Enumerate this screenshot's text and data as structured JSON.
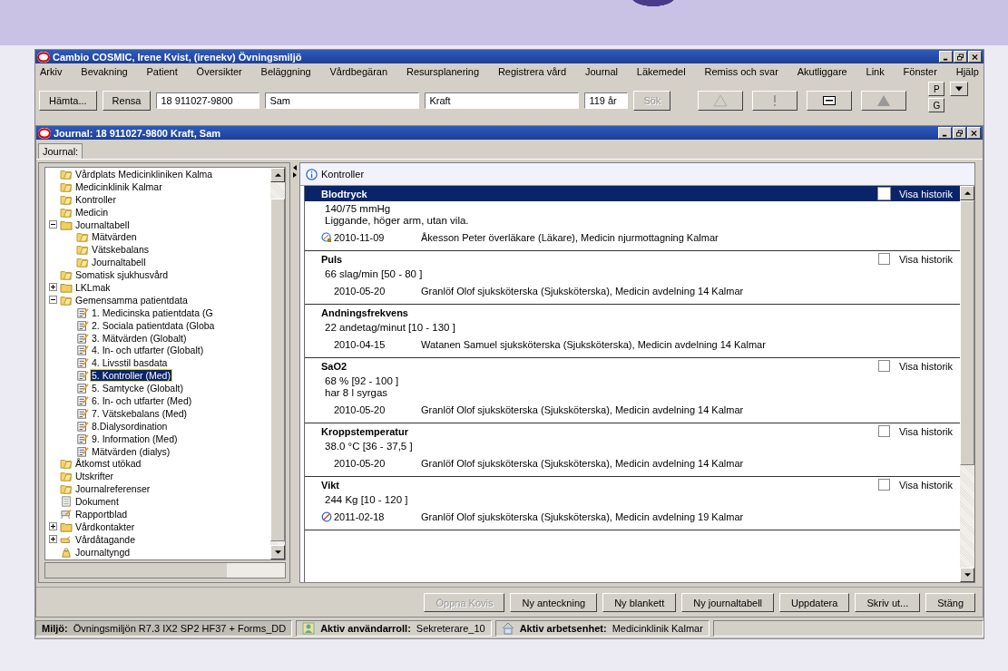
{
  "window": {
    "title": "Cambio COSMIC, Irene Kvist, (irenekv) Övningsmiljö"
  },
  "menu": [
    "Arkiv",
    "Bevakning",
    "Patient",
    "Översikter",
    "Beläggning",
    "Vårdbegäran",
    "Resursplanering",
    "Registrera vård",
    "Journal",
    "Läkemedel",
    "Remiss och svar",
    "Akutliggare",
    "Link",
    "Fönster",
    "Hjälp"
  ],
  "toolbar": {
    "fetch_button": "Hämta...",
    "clear_button": "Rensa",
    "personal_number": "18 911027-9800",
    "first_name": "Sam",
    "last_name": "Kraft",
    "age": "119 år",
    "search_button": {
      "label": "Sök",
      "disabled": true
    },
    "side_buttons": [
      "P",
      "G"
    ]
  },
  "journal_window": {
    "title": "Journal: 18 911027-9800 Kraft, Sam",
    "tabs": [
      {
        "label": "Journal:",
        "selected": true
      }
    ],
    "tree": [
      {
        "label": "Vårdplats Medicinkliniken Kalma",
        "kind": "folder",
        "selected": false
      },
      {
        "label": "Medicinklinik Kalmar",
        "kind": "folder",
        "selected": false
      },
      {
        "label": "Kontroller",
        "kind": "folder",
        "selected": false
      },
      {
        "label": "Medicin",
        "kind": "folder",
        "selected": false
      },
      {
        "label": "Journaltabell",
        "kind": "open-folder",
        "selected": false,
        "expanded": true,
        "children": [
          {
            "label": "Mätvärden",
            "kind": "folder",
            "selected": false
          },
          {
            "label": "Vätskebalans",
            "kind": "folder",
            "selected": false
          },
          {
            "label": "Journaltabell",
            "kind": "folder",
            "selected": false
          }
        ]
      },
      {
        "label": "Somatisk sjukhusvård",
        "kind": "folder",
        "selected": false
      },
      {
        "label": "LKLmak",
        "kind": "open-folder",
        "selected": false,
        "expanded": false
      },
      {
        "label": "Gemensamma patientdata",
        "kind": "folder",
        "selected": false,
        "expanded": true,
        "children": [
          {
            "label": "1. Medicinska patientdata  (G",
            "kind": "form",
            "selected": false
          },
          {
            "label": "2. Sociala patientdata  (Globa",
            "kind": "form",
            "selected": false
          },
          {
            "label": "3. Mätvärden (Globalt)",
            "kind": "form",
            "selected": false
          },
          {
            "label": "4. In- och utfarter (Globalt)",
            "kind": "form",
            "selected": false
          },
          {
            "label": "4. Livsstil basdata",
            "kind": "form",
            "selected": false
          },
          {
            "label": "5. Kontroller (Med)",
            "kind": "form",
            "selected": true
          },
          {
            "label": "5. Samtycke (Globalt)",
            "kind": "form",
            "selected": false
          },
          {
            "label": "6. In- och utfarter (Med)",
            "kind": "form",
            "selected": false
          },
          {
            "label": "7. Vätskebalans (Med)",
            "kind": "form",
            "selected": false
          },
          {
            "label": "8.Dialysordination",
            "kind": "form",
            "selected": false
          },
          {
            "label": "9. Information (Med)",
            "kind": "form",
            "selected": false
          },
          {
            "label": "Mätvärden (dialys)",
            "kind": "form",
            "selected": false
          }
        ]
      },
      {
        "label": "Åtkomst utökad",
        "kind": "folder",
        "selected": false
      },
      {
        "label": "Utskrifter",
        "kind": "folder",
        "selected": false
      },
      {
        "label": "Journalreferenser",
        "kind": "folder",
        "selected": false
      },
      {
        "label": "Dokument",
        "kind": "document",
        "selected": false
      },
      {
        "label": "Rapportblad",
        "kind": "report",
        "selected": false
      },
      {
        "label": "Vårdkontakter",
        "kind": "open-folder",
        "selected": false,
        "expanded": false
      },
      {
        "label": "Vårdåtagande",
        "kind": "hand",
        "selected": false,
        "expanded": false
      },
      {
        "label": "Journaltyngd",
        "kind": "weight",
        "selected": false
      }
    ],
    "panel": {
      "title": "Kontroller",
      "entries": [
        {
          "kind": "signed",
          "name": "Blodtryck",
          "selected": true,
          "history_label": "Visa historik",
          "history_checked": false,
          "lines": [
            "140/75 mmHg",
            "Liggande, höger arm, utan vila."
          ],
          "date": "2010-11-09",
          "author": "Åkesson Peter överläkare (Läkare), Medicin njurmottagning Kalmar"
        },
        {
          "kind": "plain",
          "name": "Puls",
          "selected": false,
          "history_label": "Visa historik",
          "history_checked": false,
          "lines": [
            "66 slag/min [50 - 80 ]"
          ],
          "date": "2010-05-20",
          "author": "Granlöf Olof sjuksköterska (Sjuksköterska), Medicin avdelning 14 Kalmar"
        },
        {
          "kind": "plain",
          "name": "Andningsfrekvens",
          "selected": false,
          "lines": [
            "22 andetag/minut [10 - 130 ]"
          ],
          "date": "2010-04-15",
          "author": "Watanen Samuel sjuksköterska (Sjuksköterska), Medicin avdelning 14 Kalmar"
        },
        {
          "kind": "plain",
          "name": "SaO2",
          "selected": false,
          "history_label": "Visa historik",
          "history_checked": false,
          "lines": [
            "68 % [92 - 100 ]",
            "har 8 l syrgas"
          ],
          "date": "2010-05-20",
          "author": "Granlöf Olof sjuksköterska (Sjuksköterska), Medicin avdelning 14 Kalmar"
        },
        {
          "kind": "plain",
          "name": "Kroppstemperatur",
          "selected": false,
          "history_label": "Visa historik",
          "history_checked": false,
          "lines": [
            "38.0 °C [36 - 37,5 ]"
          ],
          "date": "2010-05-20",
          "author": "Granlöf Olof sjuksköterska (Sjuksköterska), Medicin avdelning 14 Kalmar"
        },
        {
          "kind": "void",
          "name": "Vikt",
          "selected": false,
          "history_label": "Visa historik",
          "history_checked": false,
          "lines": [
            "244 Kg [10 - 120 ]"
          ],
          "date": "2011-02-18",
          "author": "Granlöf Olof sjuksköterska (Sjuksköterska), Medicin avdelning 19 Kalmar"
        }
      ]
    },
    "buttons": [
      {
        "label": "Öppna Kovis",
        "disabled": true
      },
      {
        "label": "Ny anteckning",
        "disabled": false
      },
      {
        "label": "Ny blankett",
        "disabled": false
      },
      {
        "label": "Ny journaltabell",
        "disabled": false
      },
      {
        "label": "Uppdatera",
        "disabled": false
      },
      {
        "label": "Skriv ut...",
        "disabled": false
      },
      {
        "label": "Stäng",
        "disabled": false
      }
    ]
  },
  "status_bar": [
    {
      "kind": "plain",
      "label": "Miljö:",
      "value": "Övningsmiljön R7.3 IX2 SP2 HF37 + Forms_DD"
    },
    {
      "kind": "person",
      "label": "Aktiv användarroll:",
      "value": "Sekreterare_10"
    },
    {
      "kind": "house",
      "label": "Aktiv arbetsenhet:",
      "value": "Medicinklinik Kalmar"
    }
  ]
}
